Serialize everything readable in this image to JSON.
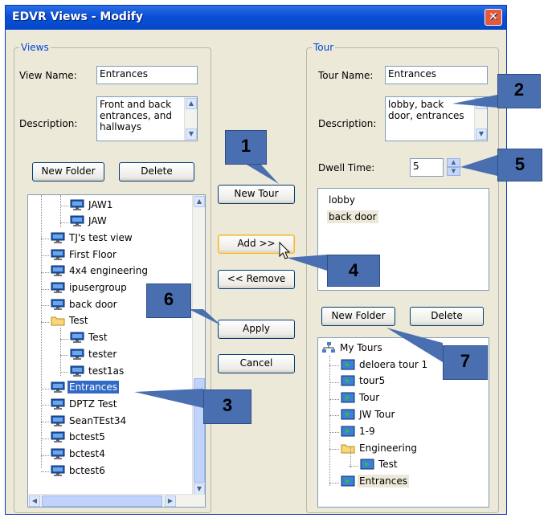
{
  "window": {
    "title": "EDVR Views - Modify",
    "close_glyph": "✕"
  },
  "views": {
    "group_label": "Views",
    "view_name_label": "View Name:",
    "view_name_value": "Entrances",
    "description_label": "Description:",
    "description_lines": [
      "Front and back",
      "entrances, and",
      "hallways"
    ],
    "new_folder_label": "New Folder",
    "delete_label": "Delete",
    "tree_items": [
      "JAW1",
      "JAW",
      "TJ's test view",
      "First Floor",
      "4x4 engineering",
      "ipusergroup",
      "back door",
      "Test",
      "Test",
      "tester",
      "test1as",
      "Entrances",
      "DPTZ Test",
      "SeanTEst34",
      "bctest5",
      "bctest4",
      "bctest6"
    ],
    "selected_item": "Entrances"
  },
  "middle": {
    "new_tour_label": "New Tour",
    "add_label": "Add >>",
    "remove_label": "<< Remove",
    "apply_label": "Apply",
    "cancel_label": "Cancel"
  },
  "tour": {
    "group_label": "Tour",
    "tour_name_label": "Tour Name:",
    "tour_name_value": "Entrances",
    "description_label": "Description:",
    "description_lines": [
      "lobby, back",
      "door, entrances"
    ],
    "dwell_label": "Dwell Time:",
    "dwell_value": "5",
    "stops": [
      "lobby",
      "back door"
    ],
    "new_folder_label": "New Folder",
    "delete_label": "Delete",
    "tree_root": "My Tours",
    "tree_items": [
      "deloera tour 1",
      "tour5",
      "Tour",
      "JW Tour",
      "1-9",
      "Engineering",
      "Test",
      "Entrances"
    ]
  },
  "callouts": [
    "1",
    "2",
    "3",
    "4",
    "5",
    "6",
    "7"
  ],
  "colors": {
    "callout_fill": "#4a6fb0",
    "title_bar": "#0a4fd6",
    "selection": "#316ac5",
    "group_label": "#0046d5"
  }
}
